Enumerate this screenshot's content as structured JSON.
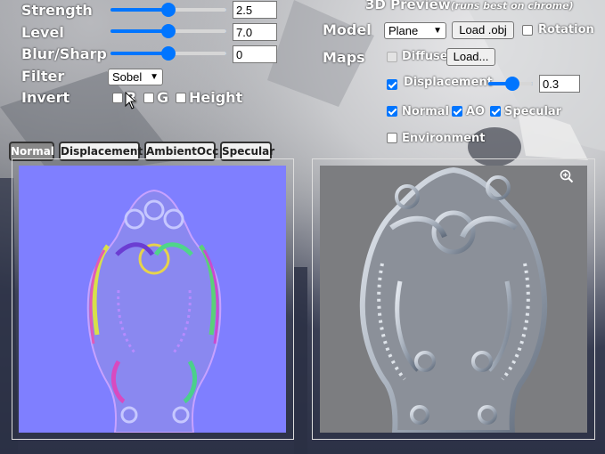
{
  "controls": {
    "strength": {
      "label": "Strength",
      "value": "2.5",
      "level": 0.5
    },
    "level": {
      "label": "Level",
      "value": "7.0",
      "level": 0.5
    },
    "blur_sharp": {
      "label": "Blur/Sharp",
      "value": "0",
      "level": 0.5
    },
    "filter": {
      "label": "Filter",
      "selected": "Sobel"
    },
    "invert": {
      "label": "Invert",
      "options": [
        "R",
        "G",
        "Height"
      ]
    }
  },
  "preview": {
    "title": "3D Preview",
    "subtitle": "(runs best on chrome)",
    "model_label": "Model",
    "model_selected": "Plane",
    "load_obj": "Load .obj",
    "rotation": "Rotation",
    "maps_label": "Maps",
    "diffuse": "Diffuse",
    "load_button": "Load...",
    "displacement": "Displacement",
    "displacement_value": "0.3",
    "displacement_level": 0.3,
    "normal": "Normal",
    "ao": "AO",
    "specular": "Specular",
    "environment": "Environment"
  },
  "tabs": [
    "Normal",
    "Displacement",
    "AmbientOcc",
    "Specular"
  ],
  "active_tab": "Normal",
  "icons": {
    "zoom": "zoom-in-icon",
    "cursor": "mouse-pointer-icon"
  },
  "colors": {
    "accent": "#0075ff",
    "normal_bg": "#7f7fff",
    "render_bg": "#7c7d80"
  }
}
